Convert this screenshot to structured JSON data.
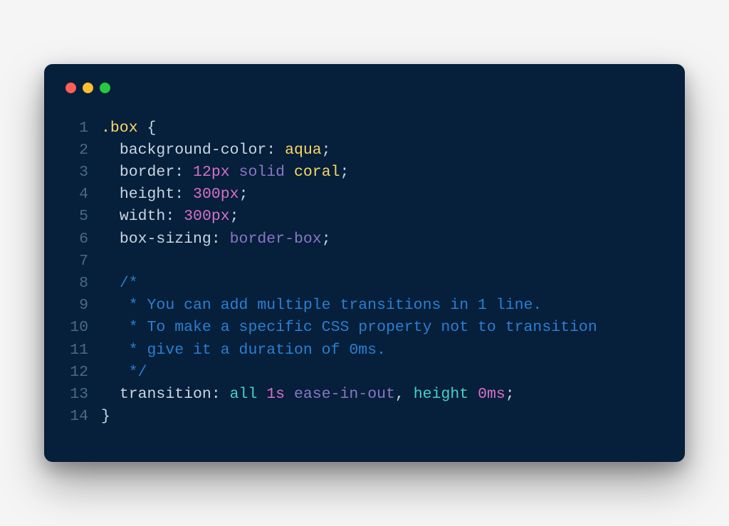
{
  "window": {
    "dots": [
      "red",
      "yellow",
      "green"
    ]
  },
  "code": {
    "lines": [
      {
        "n": "1",
        "tokens": [
          {
            "c": "c-sel",
            "t": ".box"
          },
          {
            "c": "c-plain",
            "t": " {"
          }
        ]
      },
      {
        "n": "2",
        "tokens": [
          {
            "c": "c-plain",
            "t": "  "
          },
          {
            "c": "c-prop",
            "t": "background-color"
          },
          {
            "c": "c-plain",
            "t": ": "
          },
          {
            "c": "c-aqua",
            "t": "aqua"
          },
          {
            "c": "c-plain",
            "t": ";"
          }
        ]
      },
      {
        "n": "3",
        "tokens": [
          {
            "c": "c-plain",
            "t": "  "
          },
          {
            "c": "c-prop",
            "t": "border"
          },
          {
            "c": "c-plain",
            "t": ": "
          },
          {
            "c": "c-num",
            "t": "12px"
          },
          {
            "c": "c-plain",
            "t": " "
          },
          {
            "c": "c-kw",
            "t": "solid"
          },
          {
            "c": "c-plain",
            "t": " "
          },
          {
            "c": "c-coral",
            "t": "coral"
          },
          {
            "c": "c-plain",
            "t": ";"
          }
        ]
      },
      {
        "n": "4",
        "tokens": [
          {
            "c": "c-plain",
            "t": "  "
          },
          {
            "c": "c-prop",
            "t": "height"
          },
          {
            "c": "c-plain",
            "t": ": "
          },
          {
            "c": "c-num",
            "t": "300px"
          },
          {
            "c": "c-plain",
            "t": ";"
          }
        ]
      },
      {
        "n": "5",
        "tokens": [
          {
            "c": "c-plain",
            "t": "  "
          },
          {
            "c": "c-prop",
            "t": "width"
          },
          {
            "c": "c-plain",
            "t": ": "
          },
          {
            "c": "c-num",
            "t": "300px"
          },
          {
            "c": "c-plain",
            "t": ";"
          }
        ]
      },
      {
        "n": "6",
        "tokens": [
          {
            "c": "c-plain",
            "t": "  "
          },
          {
            "c": "c-prop",
            "t": "box-sizing"
          },
          {
            "c": "c-plain",
            "t": ": "
          },
          {
            "c": "c-kw",
            "t": "border-box"
          },
          {
            "c": "c-plain",
            "t": ";"
          }
        ]
      },
      {
        "n": "7",
        "tokens": [
          {
            "c": "c-plain",
            "t": ""
          }
        ]
      },
      {
        "n": "8",
        "tokens": [
          {
            "c": "c-plain",
            "t": "  "
          },
          {
            "c": "c-comment",
            "t": "/*"
          }
        ]
      },
      {
        "n": "9",
        "tokens": [
          {
            "c": "c-plain",
            "t": "   "
          },
          {
            "c": "c-comment",
            "t": "* You can add multiple transitions in 1 line."
          }
        ]
      },
      {
        "n": "10",
        "tokens": [
          {
            "c": "c-plain",
            "t": "   "
          },
          {
            "c": "c-comment",
            "t": "* To make a specific CSS property not to transition"
          }
        ]
      },
      {
        "n": "11",
        "tokens": [
          {
            "c": "c-plain",
            "t": "   "
          },
          {
            "c": "c-comment",
            "t": "* give it a duration of 0ms."
          }
        ]
      },
      {
        "n": "12",
        "tokens": [
          {
            "c": "c-plain",
            "t": "   "
          },
          {
            "c": "c-comment",
            "t": "*/"
          }
        ]
      },
      {
        "n": "13",
        "tokens": [
          {
            "c": "c-plain",
            "t": "  "
          },
          {
            "c": "c-prop",
            "t": "transition"
          },
          {
            "c": "c-plain",
            "t": ": "
          },
          {
            "c": "c-all",
            "t": "all"
          },
          {
            "c": "c-plain",
            "t": " "
          },
          {
            "c": "c-num",
            "t": "1s"
          },
          {
            "c": "c-plain",
            "t": " "
          },
          {
            "c": "c-kw",
            "t": "ease-in-out"
          },
          {
            "c": "c-plain",
            "t": ", "
          },
          {
            "c": "c-height",
            "t": "height"
          },
          {
            "c": "c-plain",
            "t": " "
          },
          {
            "c": "c-num",
            "t": "0ms"
          },
          {
            "c": "c-plain",
            "t": ";"
          }
        ]
      },
      {
        "n": "14",
        "tokens": [
          {
            "c": "c-plain",
            "t": "}"
          }
        ]
      }
    ]
  }
}
